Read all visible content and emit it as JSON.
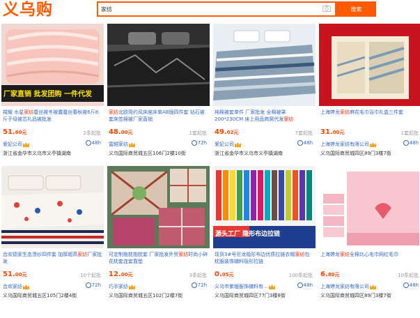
{
  "header": {
    "logo": "义乌购",
    "search_value": "家纺",
    "search_button": "搜索"
  },
  "products": [
    {
      "title_pre": "羧耀 水星",
      "title_kw": "家纺",
      "title_post": "蚕丝被冬被蠢蚕丝春秋被6斤8斤子母被芯礼品被批发",
      "price_main": "51.",
      "price_cents": "60元",
      "min_order": "2条起批",
      "shop": "爱妃公司",
      "badge": "48h",
      "address": "浙江省金华市义乌市义亭镇湖南",
      "overlay": "厂家直销 批发团购 一件代发"
    },
    {
      "title_pre": "",
      "title_kw": "家纺",
      "title_post": "北欧简约风床座床单AB版四件套 钻石被套床笠棉被厂家直销",
      "price_main": "48.",
      "price_cents": "00元",
      "min_order": "1套起批",
      "shop": "雷越家纺",
      "badge": "72h",
      "address": "义乌国际商贸城五区106门2楼10街",
      "overlay": ""
    },
    {
      "title_pre": "纯棉被套单件 厂家批发 全棉被罩200*230CM 床上用品商窝代发",
      "title_kw": "家纺",
      "title_post": "",
      "price_main": "49.",
      "price_cents": "02元",
      "min_order": "7套起批",
      "shop": "爱妃公司",
      "badge": "48h",
      "address": "浙江省金华市义乌市义亭镇湖南",
      "overlay": ""
    },
    {
      "title_pre": "上海婷龙",
      "title_kw": "家纺",
      "title_post": "麻花毛巾浴巾礼盒三件套",
      "price_main": "31.",
      "price_cents": "00元",
      "min_order": "1套起批",
      "shop": "上海婷龙家纺有限公司",
      "badge": "48h",
      "address": "义乌国际商贸城四区89门3楼7街",
      "overlay": ""
    },
    {
      "title_pre": "合欢德家生态漂纱四件套 加厚超高",
      "title_kw": "家纺",
      "title_post": "厂家批发",
      "price_main": "51.",
      "price_cents": "00元",
      "min_order": "10个起批",
      "shop": "合欢家纺",
      "badge": "72h",
      "address": "义乌国际商贸城五区105门2楼4街",
      "overlay": ""
    },
    {
      "title_pre": "可定制拖枕抱枕套 厂家批发外贸",
      "title_kw": "家纺",
      "title_post": "时尚小碎花枕套连套靠垫",
      "price_main": "12.",
      "price_cents": "00元",
      "min_order": "3条起批",
      "shop": "巧手家纺",
      "badge": "72h",
      "address": "义乌国际商贸城五区102门2楼7街",
      "overlay": ""
    },
    {
      "title_pre": "现货3#号尼龙隐形布边优质拉链衣帽",
      "title_kw": "家纺",
      "title_post": "包枕服装饰辅料隐形拉链",
      "price_main": "0.",
      "price_cents": "05元",
      "min_order": "100条起批",
      "shop": "义乌市紫银服饰辅料有...",
      "badge": "48h",
      "address": "义乌国际商贸城四区77门3楼8街",
      "overlay": "源头工厂 隐形布边拉链"
    },
    {
      "title_pre": "上海婷龙",
      "title_kw": "家纺",
      "title_post": "全棉比心毛巾网红毛巾",
      "price_main": "6.",
      "price_cents": "80元",
      "min_order": "10条起批",
      "shop": "上海婷龙家纺有限公司",
      "badge": "48h",
      "address": "义乌国际商贸城四区89门3楼7街",
      "overlay": ""
    }
  ],
  "colors": {
    "brand": "#ff5a00",
    "price": "#ff4400",
    "link": "#3366cc",
    "keyword": "#ff2b00"
  },
  "icons": {
    "camera": "camera-icon",
    "crown": "crown-icon",
    "badge": "clock-badge-icon"
  }
}
